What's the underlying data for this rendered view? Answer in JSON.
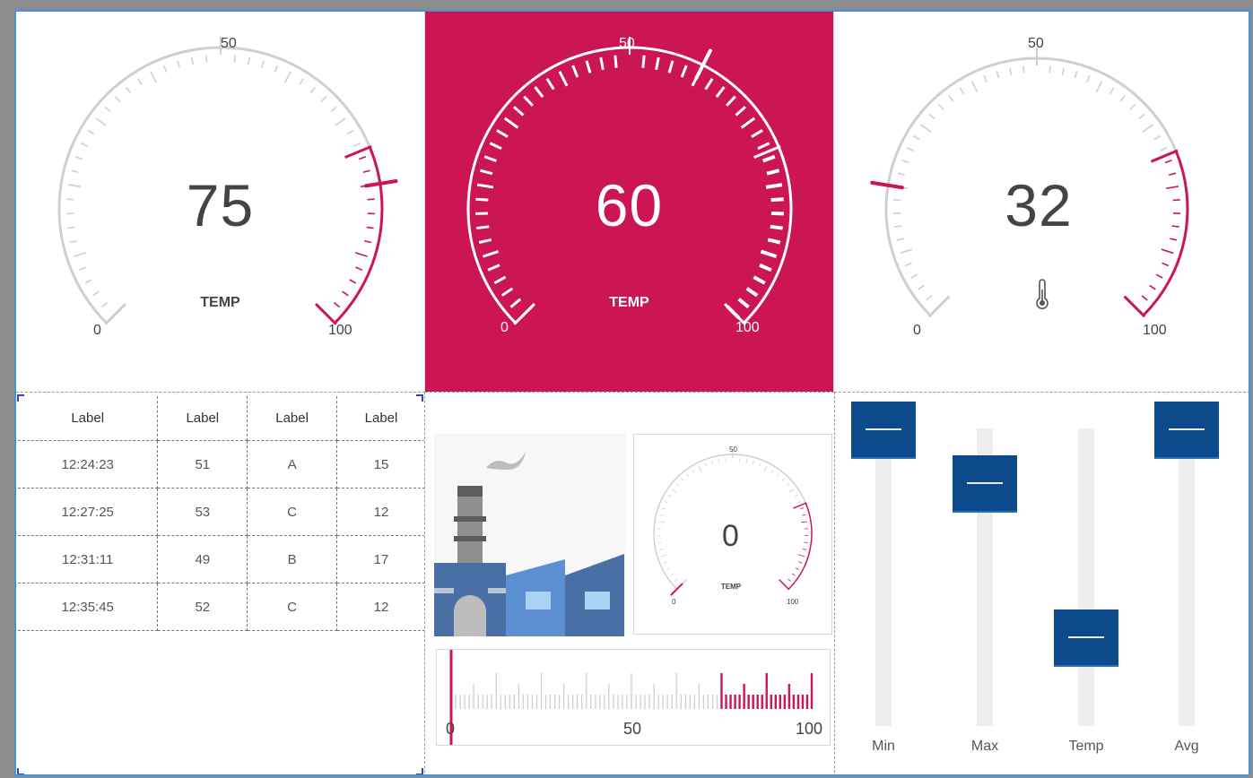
{
  "gauges": [
    {
      "value": "75",
      "label": "TEMP",
      "min": "0",
      "mid": "50",
      "max": "100",
      "marker": 80
    },
    {
      "value": "60",
      "label": "TEMP",
      "min": "0",
      "mid": "50",
      "max": "100",
      "marker": 60
    },
    {
      "value": "32",
      "label": "",
      "min": "0",
      "mid": "50",
      "max": "100",
      "marker": 20
    }
  ],
  "colors": {
    "accent": "#cc1651",
    "track": "#cccccc",
    "slider_thumb": "#0c4a8c",
    "slider_track": "#eeeeee",
    "frame": "#4a90e2"
  },
  "table": {
    "headers": [
      "Label",
      "Label",
      "Label",
      "Label"
    ],
    "rows": [
      [
        "12:24:23",
        "51",
        "A",
        "15"
      ],
      [
        "12:27:25",
        "53",
        "C",
        "12"
      ],
      [
        "12:31:11",
        "49",
        "B",
        "17"
      ],
      [
        "12:35:45",
        "52",
        "C",
        "12"
      ]
    ]
  },
  "mini_gauge": {
    "value": "0",
    "label": "TEMP",
    "min": "0",
    "mid": "50",
    "max": "100"
  },
  "linear_gauge": {
    "min": "0",
    "mid": "50",
    "max": "100",
    "value": 0
  },
  "sliders": [
    {
      "label": "Min",
      "value": 1.0
    },
    {
      "label": "Max",
      "value": 0.8
    },
    {
      "label": "Temp",
      "value": 0.22
    },
    {
      "label": "Avg",
      "value": 1.0
    }
  ],
  "icons": {
    "thermometer": "thermometer-icon",
    "factory": "factory-illustration"
  }
}
